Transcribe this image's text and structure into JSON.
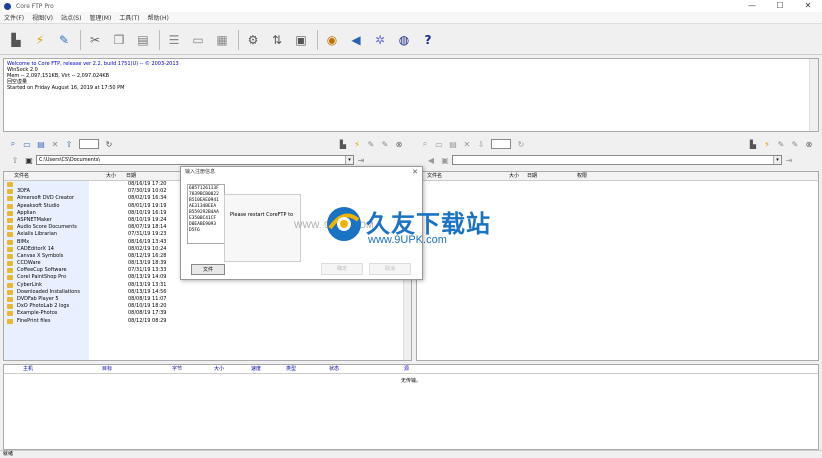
{
  "window": {
    "title": "Core FTP Pro",
    "minimize": "—",
    "maximize": "☐",
    "close": "✕"
  },
  "menu": [
    "文件(F)",
    "视图(V)",
    "站点(S)",
    "管理(M)",
    "工具(T)",
    "帮助(H)"
  ],
  "log_lines": [
    "Welcome to Core FTP, release ver 2.2, build 1751(U) -- © 2003-2013",
    "WinSock 2.0",
    "Mem -- 2,097,151KB, Virt -- 2,097,024KB",
    "回空虚量",
    "Started on Friday August 16, 2019 at 17:50 PM"
  ],
  "local_path": "C:\\Users\\CS\\Documents\\",
  "remote_path": "",
  "local_headers": {
    "name": "文件名",
    "size": "大小",
    "date": "日期"
  },
  "remote_headers": {
    "name": "文件名",
    "size": "大小",
    "date": "日期",
    "perm": "权限"
  },
  "local_files": [
    {
      "name": "",
      "date": "08/16/19 17:20"
    },
    {
      "name": "3DFA",
      "date": "07/30/19 10:02"
    },
    {
      "name": "Aimersoft DVD Creator",
      "date": "08/02/19 16:34"
    },
    {
      "name": "Apeaksoft Studio",
      "date": "08/01/19 19:19"
    },
    {
      "name": "Applian",
      "date": "08/10/19 16:19"
    },
    {
      "name": "ASPNETMaker",
      "date": "08/10/19 19:24"
    },
    {
      "name": "Audio Score Documents",
      "date": "08/07/19 18:14"
    },
    {
      "name": "Axialis Librarian",
      "date": "07/31/19 19:23"
    },
    {
      "name": "BIMx",
      "date": "08/16/19 13:43"
    },
    {
      "name": "CADEditorX 14",
      "date": "08/02/19 10:24"
    },
    {
      "name": "Canvas X Symbols",
      "date": "08/12/19 16:28"
    },
    {
      "name": "CCDWare",
      "date": "08/13/19 18:39"
    },
    {
      "name": "CoffeeCup Software",
      "date": "07/31/19 13:33"
    },
    {
      "name": "Corel PaintShop Pro",
      "date": "08/13/19 14:09"
    },
    {
      "name": "CyberLink",
      "date": "08/13/19 13:31"
    },
    {
      "name": "Downloaded Installations",
      "date": "08/13/19 14:56"
    },
    {
      "name": "DVDFab Player 5",
      "date": "08/08/19 11:07"
    },
    {
      "name": "DxO PhotoLab 2 logs",
      "date": "08/10/19 18:20"
    },
    {
      "name": "Example-Photos",
      "date": "08/08/19 17:39"
    },
    {
      "name": "FinePrint files",
      "date": "08/12/19 08:29"
    }
  ],
  "transfer_headers": [
    "主机",
    "目标",
    "字节",
    "大小",
    "速度",
    "类型",
    "状态",
    "源"
  ],
  "transfer_status": "无传输。",
  "statusbar": "就绪",
  "dialog": {
    "title": "输入注册信息",
    "key_lines": [
      "6857126113F",
      "7839BCB0022",
      "B510EAE0941",
      "AE3134BEEA",
      "B559292B4AA",
      "E350BC41CF",
      "D0EABE9093",
      "D5F6"
    ],
    "message": "Please restart CoreFTP to",
    "file_button": "文件",
    "faint_ok": "确定",
    "faint_cancel": "取消"
  },
  "watermark": {
    "text": "久友下载站",
    "url": "www.9UPK.com",
    "faint": "WWW. 9UPK. COM"
  }
}
